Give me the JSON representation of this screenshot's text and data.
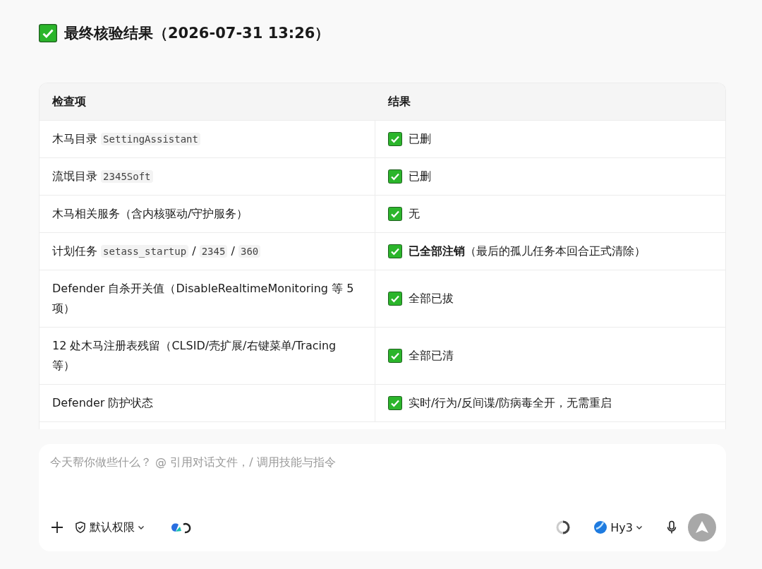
{
  "heading": {
    "title": "最终核验结果（2026-07-31 13:26）"
  },
  "table": {
    "columns": [
      "检查项",
      "结果"
    ],
    "rows": [
      {
        "item": [
          {
            "kind": "text",
            "text": "木马目录 "
          },
          {
            "kind": "code",
            "text": "SettingAssistant"
          }
        ],
        "result": "已删"
      },
      {
        "item": [
          {
            "kind": "text",
            "text": "流氓目录 "
          },
          {
            "kind": "code",
            "text": "2345Soft"
          }
        ],
        "result": "已删"
      },
      {
        "item": [
          {
            "kind": "text",
            "text": "木马相关服务（含内核驱动/守护服务）"
          }
        ],
        "result": "无"
      },
      {
        "item": [
          {
            "kind": "text",
            "text": "计划任务 "
          },
          {
            "kind": "code",
            "text": "setass_startup"
          },
          {
            "kind": "text",
            "text": " / "
          },
          {
            "kind": "code",
            "text": "2345"
          },
          {
            "kind": "text",
            "text": " / "
          },
          {
            "kind": "code",
            "text": "360"
          }
        ],
        "result": "**已全部注销**（最后的孤儿任务本回合正式清除）"
      },
      {
        "item": [
          {
            "kind": "text",
            "text": "Defender 自杀开关值（DisableRealtimeMonitoring 等 5 项）"
          }
        ],
        "result": "全部已拔"
      },
      {
        "item": [
          {
            "kind": "text",
            "text": "12 处木马注册表残留（CLSID/壳扩展/右键菜单/Tracing 等）"
          }
        ],
        "result": "全部已清"
      },
      {
        "item": [
          {
            "kind": "text",
            "text": "Defender 防护状态"
          }
        ],
        "result": "实时/行为/反间谍/防病毒全开，无需重启"
      }
    ]
  },
  "composer": {
    "placeholder": "今天帮你做些什么？ @ 引用对话文件，/ 调用技能与指令",
    "permission": "默认权限",
    "model": "Hy3"
  }
}
